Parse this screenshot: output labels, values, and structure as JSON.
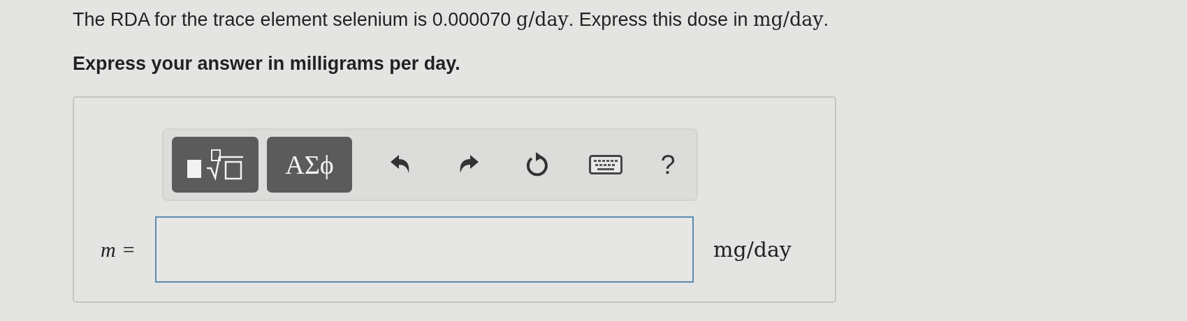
{
  "question": [
    {
      "kind": "text",
      "text": "The RDA for the trace element selenium is 0.000070 "
    },
    {
      "kind": "math",
      "text": "g/day"
    },
    {
      "kind": "text",
      "text": ". Express this dose in "
    },
    {
      "kind": "math",
      "text": "mg/day"
    },
    {
      "kind": "text",
      "text": "."
    }
  ],
  "instruction": "Express your answer in milligrams per day.",
  "toolbar": [
    {
      "kind": "templates"
    },
    {
      "kind": "symbols",
      "label": "ΑΣϕ"
    },
    {
      "kind": "undo"
    },
    {
      "kind": "redo"
    },
    {
      "kind": "reset"
    },
    {
      "kind": "keyboard"
    },
    {
      "kind": "help",
      "label": "?"
    }
  ],
  "answer": {
    "variable": "m",
    "equals": "=",
    "unit": "mg/day"
  }
}
